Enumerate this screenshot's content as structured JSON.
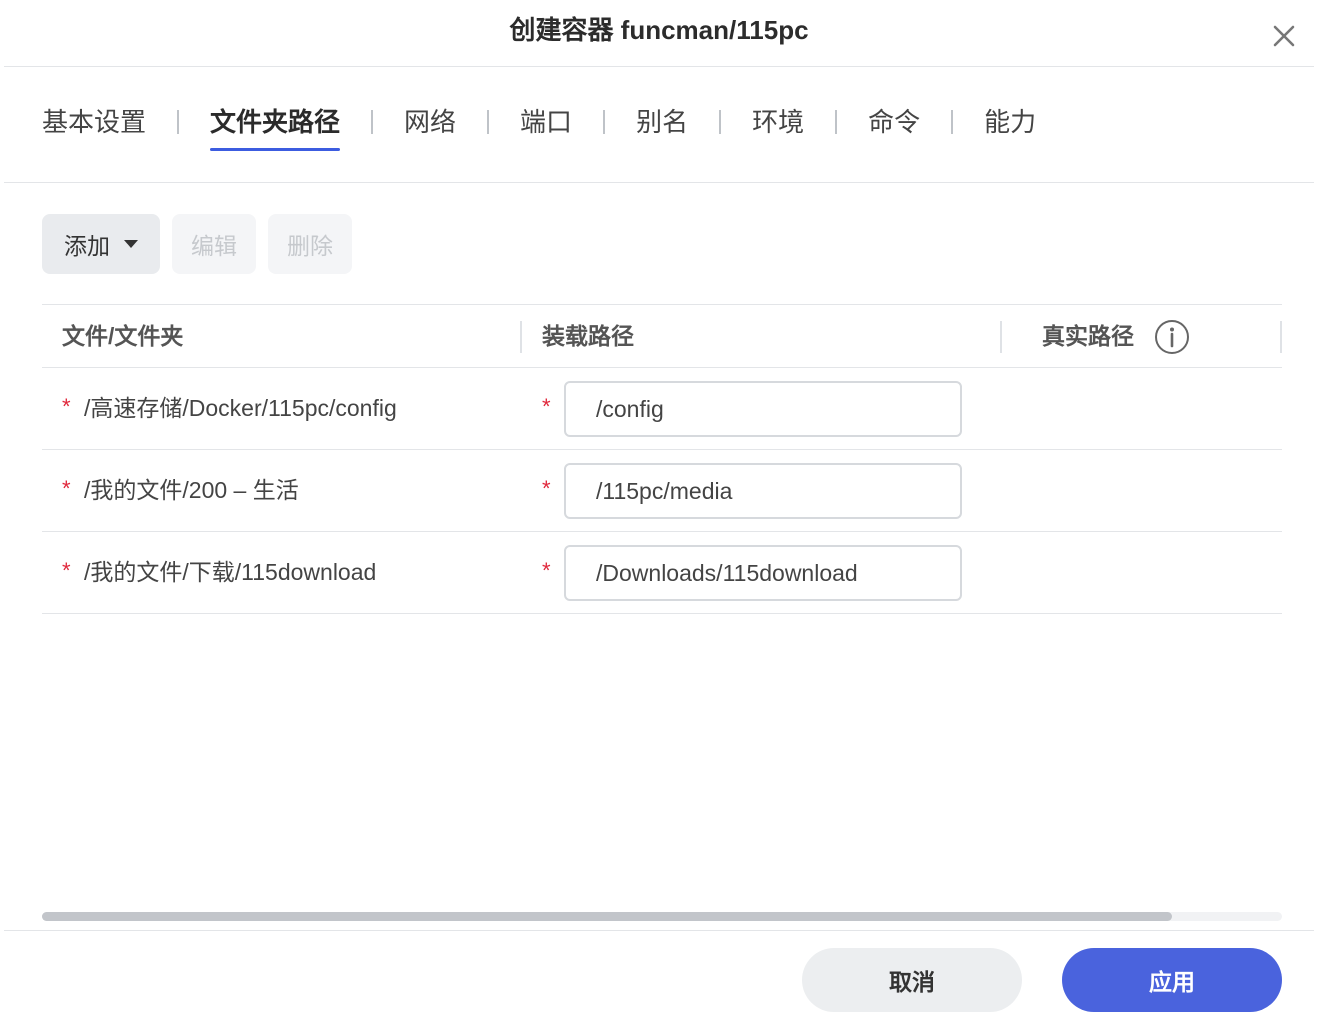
{
  "dialog": {
    "title": "创建容器 funcman/115pc",
    "close_icon": "close-icon"
  },
  "tabs": [
    {
      "label": "基本设置",
      "active": false
    },
    {
      "label": "文件夹路径",
      "active": true
    },
    {
      "label": "网络",
      "active": false
    },
    {
      "label": "端口",
      "active": false
    },
    {
      "label": "别名",
      "active": false
    },
    {
      "label": "环境",
      "active": false
    },
    {
      "label": "命令",
      "active": false
    },
    {
      "label": "能力",
      "active": false
    }
  ],
  "toolbar": {
    "add_label": "添加",
    "edit_label": "编辑",
    "delete_label": "删除"
  },
  "table": {
    "columns": [
      "文件/文件夹",
      "装载路径",
      "真实路径"
    ],
    "required_mark": "*",
    "rows": [
      {
        "source": "/高速存储/Docker/115pc/config",
        "mount": "/config"
      },
      {
        "source": "/我的文件/200 – 生活",
        "mount": "/115pc/media"
      },
      {
        "source": "/我的文件/下载/115download",
        "mount": "/Downloads/115download"
      }
    ]
  },
  "footer": {
    "cancel_label": "取消",
    "apply_label": "应用"
  },
  "colors": {
    "accent": "#4a63dd",
    "tab_underline": "#3c5ce0",
    "required": "#e0283c"
  }
}
